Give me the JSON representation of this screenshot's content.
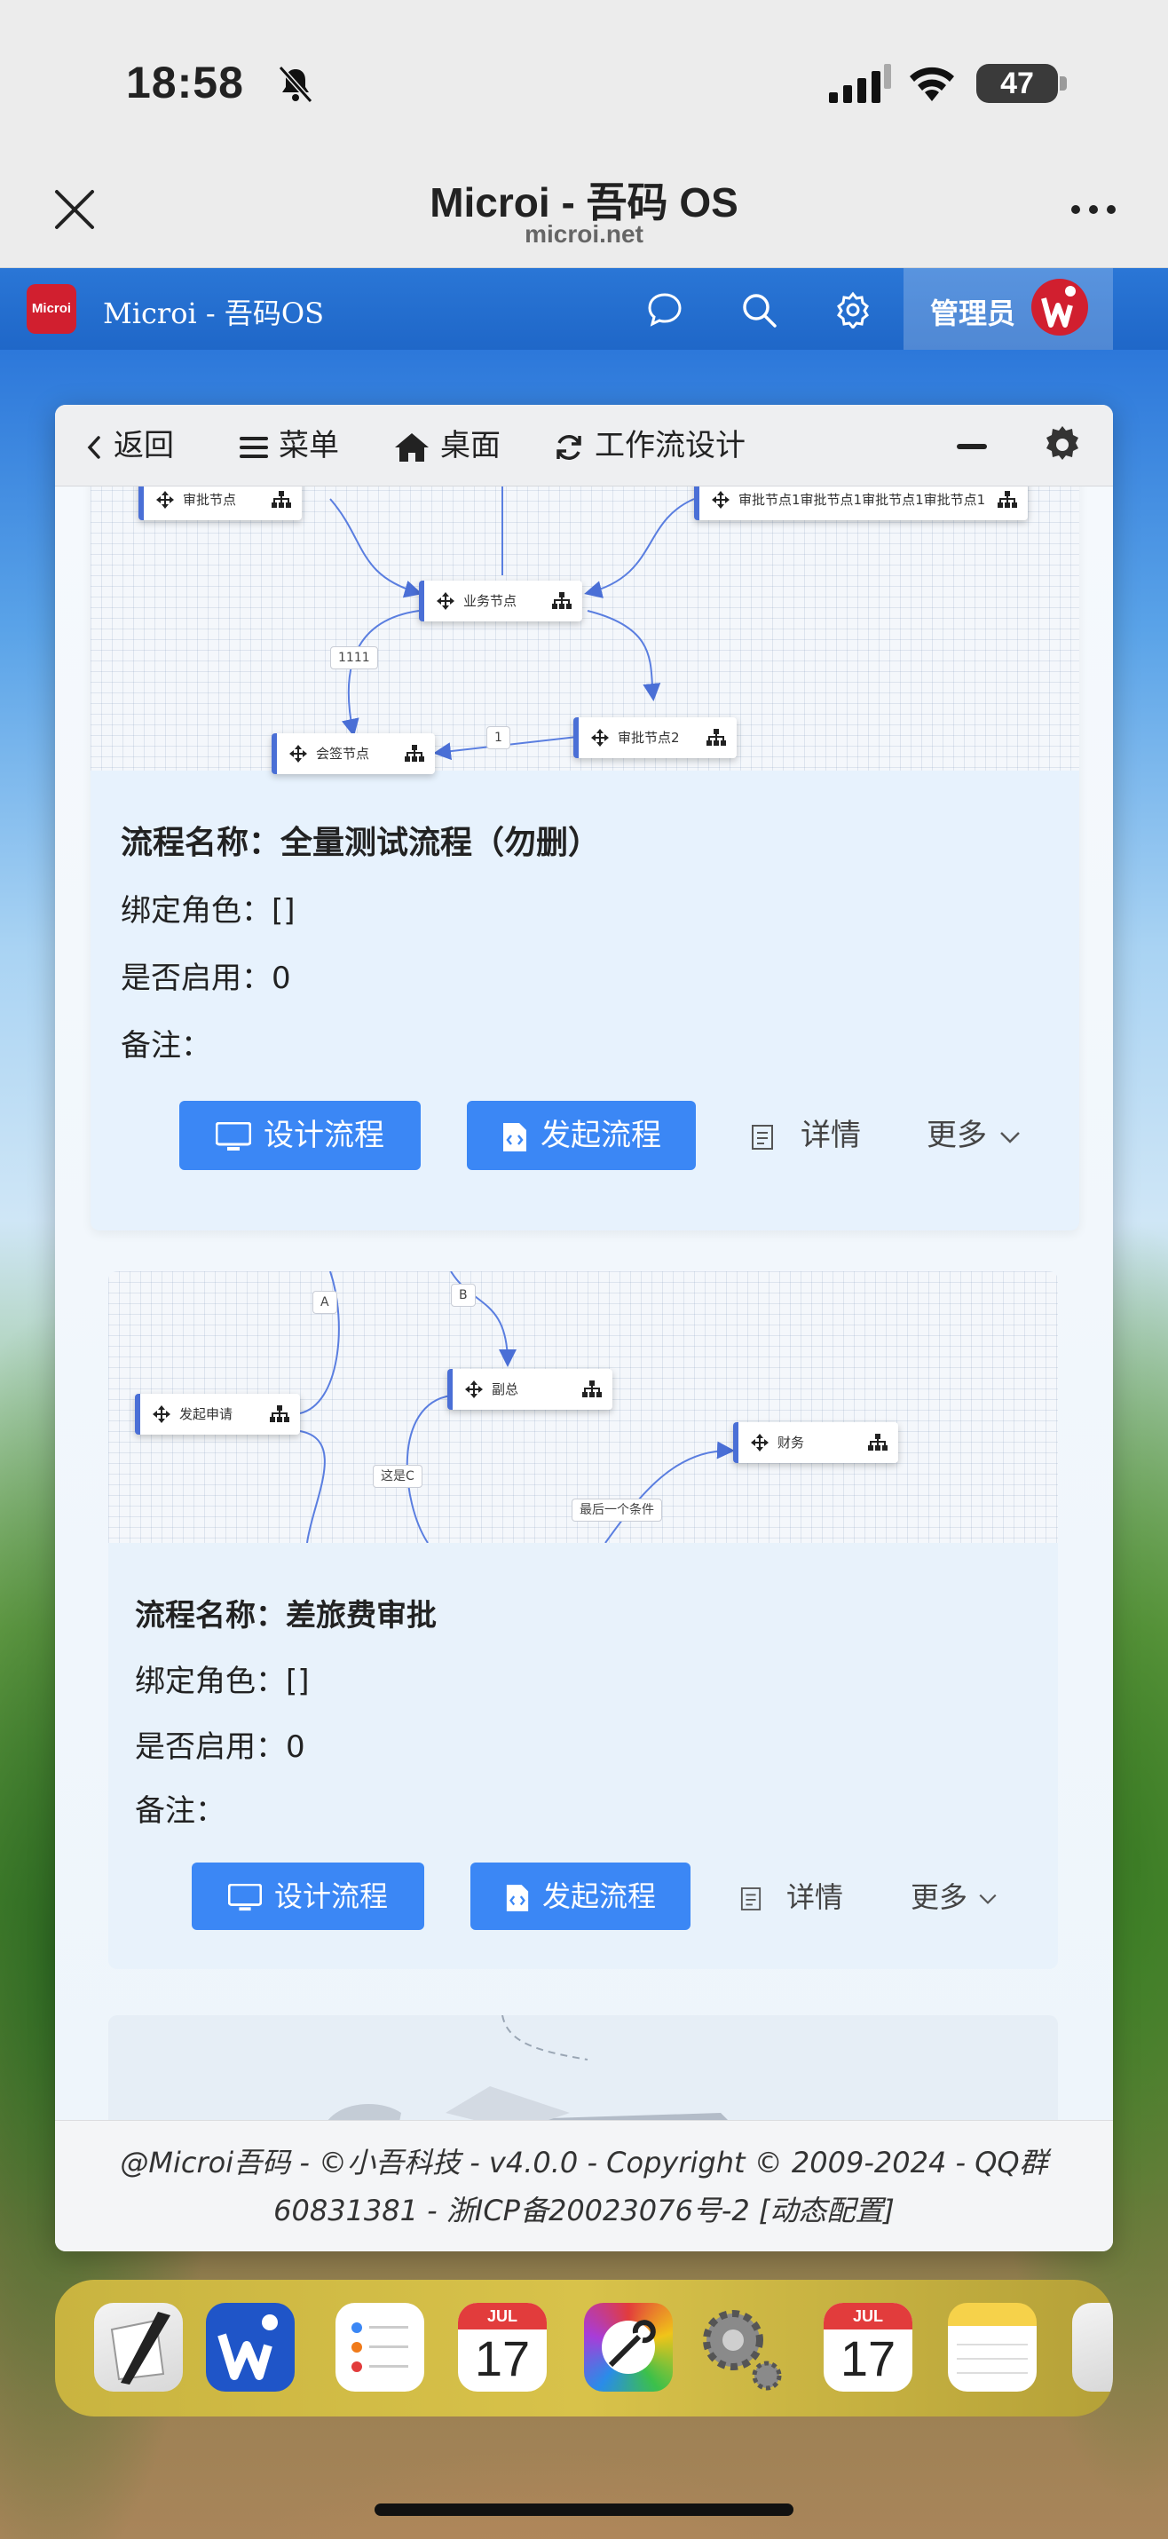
{
  "status_bar": {
    "time": "18:58",
    "battery": "47"
  },
  "browser": {
    "title": "Microi - 吾码 OS",
    "url": "microi.net"
  },
  "app_header": {
    "logo_text": "Microi",
    "title": "Microi - 吾码OS",
    "admin_label": "管理员"
  },
  "window_toolbar": {
    "back": "返回",
    "menu": "菜单",
    "desktop": "桌面",
    "title": "工作流设计"
  },
  "workflows": [
    {
      "diagram": {
        "nodes": [
          "审批节点",
          "审批节点1审批节点1审批节点1审批节点1",
          "业务节点",
          "审批节点2",
          "会签节点"
        ],
        "edge_labels": [
          "1111",
          "1"
        ]
      },
      "name_label": "流程名称：",
      "name": "全量测试流程（勿删）",
      "role_label": "绑定角色：",
      "role": "[]",
      "enabled_label": "是否启用：",
      "enabled": "0",
      "remark_label": "备注：",
      "remark": "",
      "design_button": "设计流程",
      "start_button": "发起流程",
      "detail_button": "详情",
      "more_button": "更多"
    },
    {
      "diagram": {
        "nodes": [
          "发起申请",
          "副总",
          "财务"
        ],
        "edge_labels": [
          "A",
          "B",
          "这是C",
          "最后一个条件"
        ]
      },
      "name_label": "流程名称：",
      "name": "差旅费审批",
      "role_label": "绑定角色：",
      "role": "[]",
      "enabled_label": "是否启用：",
      "enabled": "0",
      "remark_label": "备注：",
      "remark": "",
      "design_button": "设计流程",
      "start_button": "发起流程",
      "detail_button": "详情",
      "more_button": "更多"
    }
  ],
  "footer": {
    "line1": "@Microi吾码 - ©小吾科技 - v4.0.0 - Copyright © 2009-2024 - QQ群",
    "line2": "60831381 - 浙ICP备20023076号-2 [动态配置]"
  },
  "dock": {
    "calendar_month": "JUL",
    "calendar_day": "17",
    "calendar2_month": "JUL",
    "calendar2_day": "17"
  },
  "colors": {
    "primary": "#3b87f5",
    "app_bar": "#1f67c8",
    "brand_red": "#d11f2f",
    "node_border": "#4a6fd6"
  }
}
